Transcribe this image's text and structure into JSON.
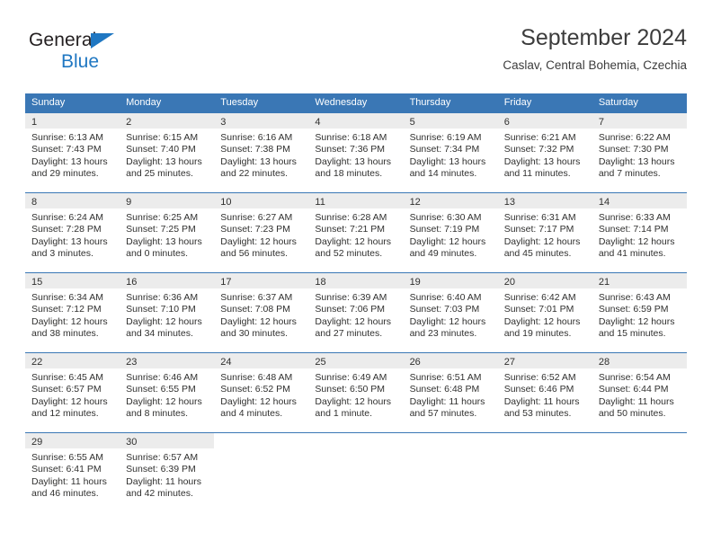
{
  "brand": {
    "name_dark": "General",
    "name_blue": "Blue",
    "accent_color": "#1f77c2"
  },
  "header": {
    "title": "September 2024",
    "subtitle": "Caslav, Central Bohemia, Czechia"
  },
  "calendar": {
    "header_color": "#3a77b5",
    "daynum_band_color": "#ececec",
    "weekdays": [
      "Sunday",
      "Monday",
      "Tuesday",
      "Wednesday",
      "Thursday",
      "Friday",
      "Saturday"
    ],
    "weeks": [
      [
        {
          "day": "1",
          "sunrise": "Sunrise: 6:13 AM",
          "sunset": "Sunset: 7:43 PM",
          "daylight_1": "Daylight: 13 hours",
          "daylight_2": "and 29 minutes."
        },
        {
          "day": "2",
          "sunrise": "Sunrise: 6:15 AM",
          "sunset": "Sunset: 7:40 PM",
          "daylight_1": "Daylight: 13 hours",
          "daylight_2": "and 25 minutes."
        },
        {
          "day": "3",
          "sunrise": "Sunrise: 6:16 AM",
          "sunset": "Sunset: 7:38 PM",
          "daylight_1": "Daylight: 13 hours",
          "daylight_2": "and 22 minutes."
        },
        {
          "day": "4",
          "sunrise": "Sunrise: 6:18 AM",
          "sunset": "Sunset: 7:36 PM",
          "daylight_1": "Daylight: 13 hours",
          "daylight_2": "and 18 minutes."
        },
        {
          "day": "5",
          "sunrise": "Sunrise: 6:19 AM",
          "sunset": "Sunset: 7:34 PM",
          "daylight_1": "Daylight: 13 hours",
          "daylight_2": "and 14 minutes."
        },
        {
          "day": "6",
          "sunrise": "Sunrise: 6:21 AM",
          "sunset": "Sunset: 7:32 PM",
          "daylight_1": "Daylight: 13 hours",
          "daylight_2": "and 11 minutes."
        },
        {
          "day": "7",
          "sunrise": "Sunrise: 6:22 AM",
          "sunset": "Sunset: 7:30 PM",
          "daylight_1": "Daylight: 13 hours",
          "daylight_2": "and 7 minutes."
        }
      ],
      [
        {
          "day": "8",
          "sunrise": "Sunrise: 6:24 AM",
          "sunset": "Sunset: 7:28 PM",
          "daylight_1": "Daylight: 13 hours",
          "daylight_2": "and 3 minutes."
        },
        {
          "day": "9",
          "sunrise": "Sunrise: 6:25 AM",
          "sunset": "Sunset: 7:25 PM",
          "daylight_1": "Daylight: 13 hours",
          "daylight_2": "and 0 minutes."
        },
        {
          "day": "10",
          "sunrise": "Sunrise: 6:27 AM",
          "sunset": "Sunset: 7:23 PM",
          "daylight_1": "Daylight: 12 hours",
          "daylight_2": "and 56 minutes."
        },
        {
          "day": "11",
          "sunrise": "Sunrise: 6:28 AM",
          "sunset": "Sunset: 7:21 PM",
          "daylight_1": "Daylight: 12 hours",
          "daylight_2": "and 52 minutes."
        },
        {
          "day": "12",
          "sunrise": "Sunrise: 6:30 AM",
          "sunset": "Sunset: 7:19 PM",
          "daylight_1": "Daylight: 12 hours",
          "daylight_2": "and 49 minutes."
        },
        {
          "day": "13",
          "sunrise": "Sunrise: 6:31 AM",
          "sunset": "Sunset: 7:17 PM",
          "daylight_1": "Daylight: 12 hours",
          "daylight_2": "and 45 minutes."
        },
        {
          "day": "14",
          "sunrise": "Sunrise: 6:33 AM",
          "sunset": "Sunset: 7:14 PM",
          "daylight_1": "Daylight: 12 hours",
          "daylight_2": "and 41 minutes."
        }
      ],
      [
        {
          "day": "15",
          "sunrise": "Sunrise: 6:34 AM",
          "sunset": "Sunset: 7:12 PM",
          "daylight_1": "Daylight: 12 hours",
          "daylight_2": "and 38 minutes."
        },
        {
          "day": "16",
          "sunrise": "Sunrise: 6:36 AM",
          "sunset": "Sunset: 7:10 PM",
          "daylight_1": "Daylight: 12 hours",
          "daylight_2": "and 34 minutes."
        },
        {
          "day": "17",
          "sunrise": "Sunrise: 6:37 AM",
          "sunset": "Sunset: 7:08 PM",
          "daylight_1": "Daylight: 12 hours",
          "daylight_2": "and 30 minutes."
        },
        {
          "day": "18",
          "sunrise": "Sunrise: 6:39 AM",
          "sunset": "Sunset: 7:06 PM",
          "daylight_1": "Daylight: 12 hours",
          "daylight_2": "and 27 minutes."
        },
        {
          "day": "19",
          "sunrise": "Sunrise: 6:40 AM",
          "sunset": "Sunset: 7:03 PM",
          "daylight_1": "Daylight: 12 hours",
          "daylight_2": "and 23 minutes."
        },
        {
          "day": "20",
          "sunrise": "Sunrise: 6:42 AM",
          "sunset": "Sunset: 7:01 PM",
          "daylight_1": "Daylight: 12 hours",
          "daylight_2": "and 19 minutes."
        },
        {
          "day": "21",
          "sunrise": "Sunrise: 6:43 AM",
          "sunset": "Sunset: 6:59 PM",
          "daylight_1": "Daylight: 12 hours",
          "daylight_2": "and 15 minutes."
        }
      ],
      [
        {
          "day": "22",
          "sunrise": "Sunrise: 6:45 AM",
          "sunset": "Sunset: 6:57 PM",
          "daylight_1": "Daylight: 12 hours",
          "daylight_2": "and 12 minutes."
        },
        {
          "day": "23",
          "sunrise": "Sunrise: 6:46 AM",
          "sunset": "Sunset: 6:55 PM",
          "daylight_1": "Daylight: 12 hours",
          "daylight_2": "and 8 minutes."
        },
        {
          "day": "24",
          "sunrise": "Sunrise: 6:48 AM",
          "sunset": "Sunset: 6:52 PM",
          "daylight_1": "Daylight: 12 hours",
          "daylight_2": "and 4 minutes."
        },
        {
          "day": "25",
          "sunrise": "Sunrise: 6:49 AM",
          "sunset": "Sunset: 6:50 PM",
          "daylight_1": "Daylight: 12 hours",
          "daylight_2": "and 1 minute."
        },
        {
          "day": "26",
          "sunrise": "Sunrise: 6:51 AM",
          "sunset": "Sunset: 6:48 PM",
          "daylight_1": "Daylight: 11 hours",
          "daylight_2": "and 57 minutes."
        },
        {
          "day": "27",
          "sunrise": "Sunrise: 6:52 AM",
          "sunset": "Sunset: 6:46 PM",
          "daylight_1": "Daylight: 11 hours",
          "daylight_2": "and 53 minutes."
        },
        {
          "day": "28",
          "sunrise": "Sunrise: 6:54 AM",
          "sunset": "Sunset: 6:44 PM",
          "daylight_1": "Daylight: 11 hours",
          "daylight_2": "and 50 minutes."
        }
      ],
      [
        {
          "day": "29",
          "sunrise": "Sunrise: 6:55 AM",
          "sunset": "Sunset: 6:41 PM",
          "daylight_1": "Daylight: 11 hours",
          "daylight_2": "and 46 minutes."
        },
        {
          "day": "30",
          "sunrise": "Sunrise: 6:57 AM",
          "sunset": "Sunset: 6:39 PM",
          "daylight_1": "Daylight: 11 hours",
          "daylight_2": "and 42 minutes."
        },
        {
          "day": "",
          "sunrise": "",
          "sunset": "",
          "daylight_1": "",
          "daylight_2": ""
        },
        {
          "day": "",
          "sunrise": "",
          "sunset": "",
          "daylight_1": "",
          "daylight_2": ""
        },
        {
          "day": "",
          "sunrise": "",
          "sunset": "",
          "daylight_1": "",
          "daylight_2": ""
        },
        {
          "day": "",
          "sunrise": "",
          "sunset": "",
          "daylight_1": "",
          "daylight_2": ""
        },
        {
          "day": "",
          "sunrise": "",
          "sunset": "",
          "daylight_1": "",
          "daylight_2": ""
        }
      ]
    ]
  }
}
